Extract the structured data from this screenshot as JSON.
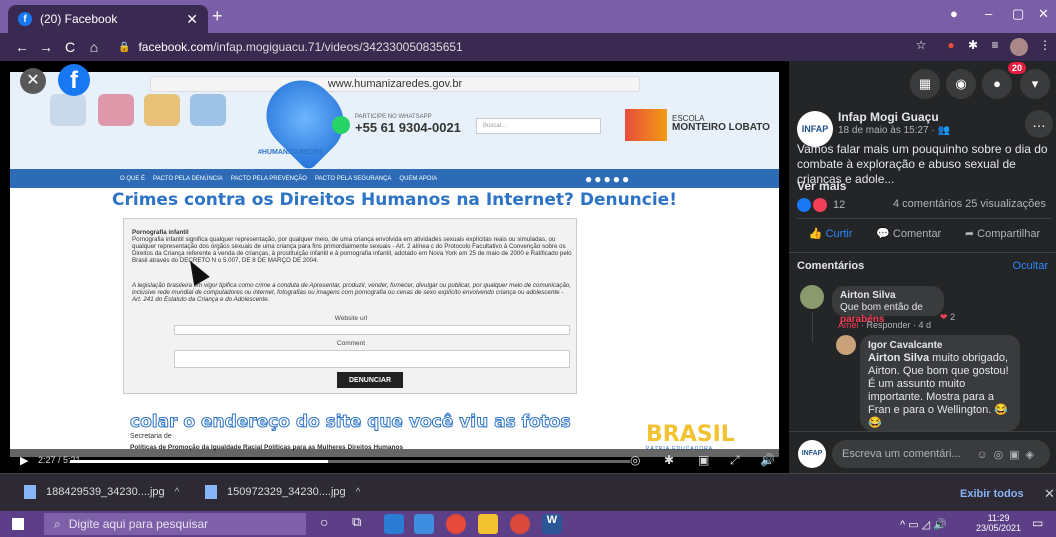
{
  "browser": {
    "tab_title": "(20) Facebook",
    "tab_close": "✕",
    "new_tab": "+",
    "url_host": "facebook.com",
    "url_path": "/infap.mogiguacu.71/videos/342330050835651",
    "minimize": "–",
    "maximize": "▢",
    "close": "✕"
  },
  "site": {
    "url": "www.humanizaredes.gov.br",
    "whatsapp_label": "PARTICIPE NO WHATSAPP",
    "phone": "+55 61 9304-0021",
    "search_placeholder": "Buscar...",
    "brand": "#HUMANIZAREDES",
    "school_top": "ESCOLA",
    "school_name": "MONTEIRO LOBATO",
    "nav": [
      "O QUE É",
      "PACTO PELA DENÚNCIA",
      "PACTO PELA PREVENÇÃO",
      "PACTO PELA SEGURANÇA",
      "QUEM APOIA"
    ],
    "headline": "Crimes contra os Direitos Humanos na Internet? Denuncie!",
    "form_title": "Pornografia infantil",
    "form_text": "Pornografia infantil significa qualquer representação, por qualquer meio, de uma criança envolvida em atividades sexuais explícitas reais ou simuladas, ou qualquer representação dos órgãos sexuais de uma criança para fins primordialmente sexuais - Art. 2 alínea c do Protocolo Facultativo à Convenção sobre os Direitos da Criança referente à venda de crianças, à prostituição infantil e à pornografia infantil, adotado em Nova York em 25 de maio de 2000 e Ratificado pelo Brasil através do DECRETO N o 5.007, DE 8 DE MARÇO DE 2004.",
    "form_text2": "A legislação brasileira em vigor tipifica como crime a conduta de Apresentar, produzir, vender, fornecer, divulgar ou publicar, por qualquer meio de comunicação, inclusive rede mundial de computadores ou internet, fotografias ou imagens com pornografia ou cenas de sexo explícito envolvendo criança ou adolescente - Art. 241 do Estatuto da Criança e do Adolescente.",
    "website_label": "Website url",
    "comment_label": "Comment",
    "submit": "DENUNCIAR",
    "caption": "colar o endereço do site que você viu as fotos",
    "secretaria": "Secretaria de",
    "politicas": "Políticas de Promoção da Igualdade Racial     Políticas para as Mulheres     Direitos Humanos",
    "brasil": "BRASIL",
    "patria": "PÁTRIA EDUCADORA"
  },
  "video": {
    "time": "2:27 / 5:21",
    "progress": 0.46
  },
  "post": {
    "page_name": "Infap Mogi Guaçu",
    "date": "18 de maio às 15:27 · ",
    "text": "Vamos falar mais um pouquinho sobre o dia do combate à exploração e abuso sexual de crianças e adole...",
    "see_more": "Ver mais",
    "reactions_count": "12",
    "stats": "4 comentários  25 visualizações",
    "like": "Curtir",
    "comment": "Comentar",
    "share": "Compartilhar",
    "comments_label": "Comentários",
    "hide": "Ocultar",
    "notif_count": "20"
  },
  "comments": [
    {
      "author": "Airton Silva",
      "text": "Que bom então de ",
      "highlight": "parabéns",
      "meta_name": "Amei",
      "meta_rest": " · Responder · 4 d",
      "reacts": "2"
    },
    {
      "author": "Igor Cavalcante",
      "mention": "Airton Silva",
      "text": " muito obrigado, Airton. Que bom que gostou! É um assunto muito importante. Mostra para a Fran e para o Wellington. 😂😂"
    }
  ],
  "comment_input_placeholder": "Escreva um comentári...",
  "downloads": {
    "file1": "188429539_34230....jpg",
    "file2": "150972329_34230....jpg",
    "show_all": "Exibir todos"
  },
  "taskbar": {
    "search": "Digite aqui para pesquisar",
    "time": "11:29",
    "date": "23/05/2021"
  },
  "colors": {
    "tab_bar": "#7b5ea8",
    "facebook_blue": "#1877f2",
    "taskbar": "#5c3f86"
  }
}
